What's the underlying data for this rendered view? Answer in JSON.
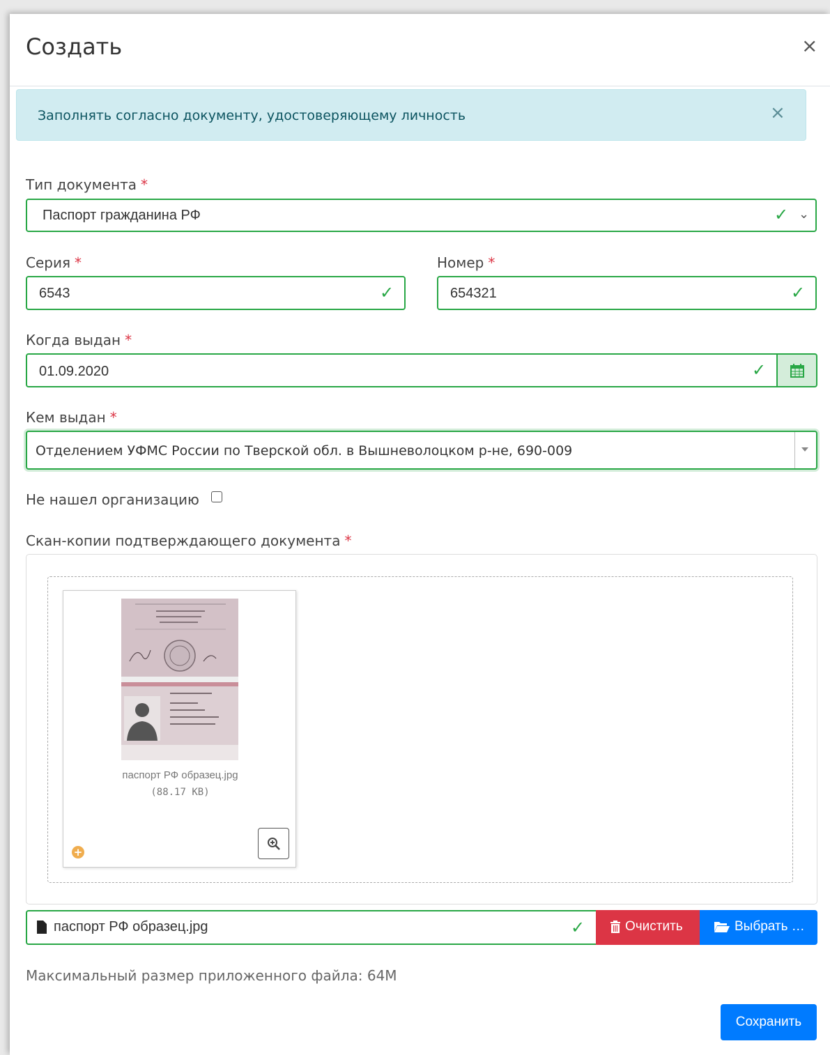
{
  "modal": {
    "title": "Создать",
    "close_glyph": "×"
  },
  "alert": {
    "text": "Заполнять согласно документу, удостоверяющему личность",
    "close_glyph": "×"
  },
  "form": {
    "required_mark": "*",
    "doc_type": {
      "label": "Тип документа",
      "value": "Паспорт гражданина РФ"
    },
    "series": {
      "label": "Серия",
      "value": "6543"
    },
    "number": {
      "label": "Номер",
      "value": "654321"
    },
    "issued_date": {
      "label": "Когда выдан",
      "value": "01.09.2020"
    },
    "issued_by": {
      "label": "Кем выдан",
      "value": "Отделением УФМС России по Тверской обл. в Вышневолоцком р-не, 690-009"
    },
    "not_found_org": {
      "label": "Не нашел организацию",
      "checked": false
    },
    "scans": {
      "label": "Скан-копии подтверждающего документа"
    }
  },
  "upload": {
    "thumb_name": "паспорт РФ образец.jpg",
    "thumb_size": "(88.17 KB)",
    "selected_file": "паспорт РФ образец.jpg",
    "clear_label": "Очистить",
    "pick_label": "Выбрать …",
    "max_size_hint": "Максимальный размер приложенного файла: 64M"
  },
  "footer": {
    "save_label": "Сохранить"
  },
  "colors": {
    "success": "#28a745",
    "danger": "#dc3545",
    "primary": "#007bff",
    "info_bg": "#d1ecf1",
    "info_text": "#0c5460"
  },
  "icons": [
    "close-icon",
    "check-icon",
    "chevron-down-icon",
    "calendar-icon",
    "caret-down-icon",
    "file-icon",
    "trash-icon",
    "folder-open-icon",
    "zoom-in-icon",
    "plus-circle-icon"
  ]
}
